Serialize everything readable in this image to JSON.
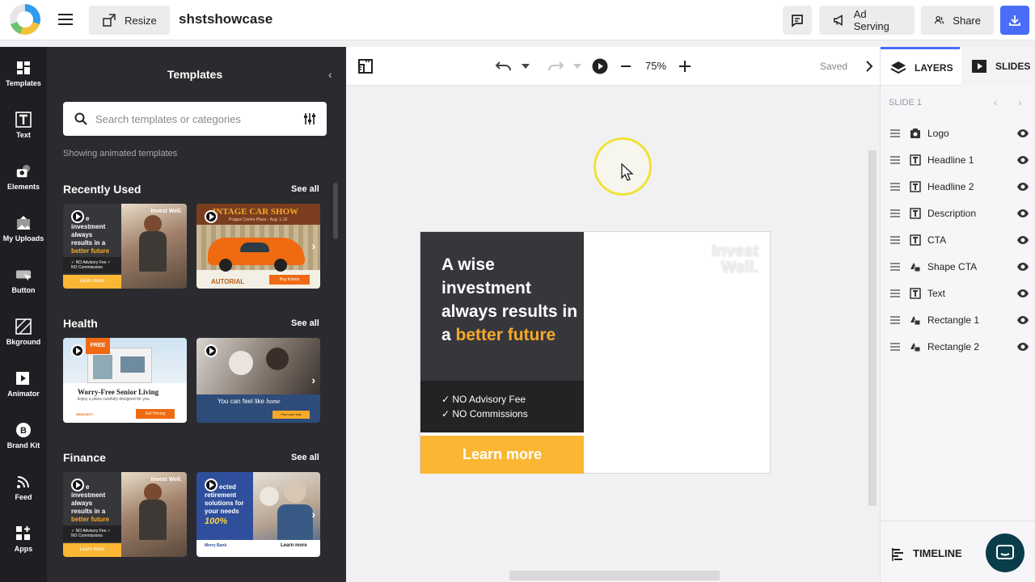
{
  "app": {
    "doc_title": "shstshowcase",
    "resize_label": "Resize",
    "ad_serving_label": "Ad Serving",
    "share_label": "Share"
  },
  "rail": [
    {
      "label": "Templates",
      "icon": "templates-icon"
    },
    {
      "label": "Text",
      "icon": "text-icon"
    },
    {
      "label": "Elements",
      "icon": "elements-icon"
    },
    {
      "label": "My Uploads",
      "icon": "uploads-icon"
    },
    {
      "label": "Button",
      "icon": "button-icon"
    },
    {
      "label": "Bkground",
      "icon": "background-icon"
    },
    {
      "label": "Animator",
      "icon": "animator-icon"
    },
    {
      "label": "Brand Kit",
      "icon": "brand-kit-icon"
    },
    {
      "label": "Feed",
      "icon": "feed-icon"
    },
    {
      "label": "Apps",
      "icon": "apps-icon"
    }
  ],
  "panel": {
    "title": "Templates",
    "search_placeholder": "Search templates or categories",
    "showing": "Showing animated templates",
    "see_all": "See all",
    "sections": [
      {
        "title": "Recently Used"
      },
      {
        "title": "Health"
      },
      {
        "title": "Finance"
      }
    ],
    "thumbs": {
      "invest_line1": "e",
      "invest_line2": "investment",
      "invest_line3": "always",
      "invest_line4": "results in a",
      "invest_accent": "better future",
      "invest_logo": "Invest Well.",
      "invest_desc": "✓ NO Advisory Fee ✓ NO Commissions",
      "invest_cta": "Learn more",
      "car_title": "INTAGE CAR SHOW",
      "car_sub": "Prague Centre Plaza · Aug. 1-15",
      "car_brand": "AUTORIAL",
      "car_cta": "Buy tickets",
      "senior_badge": "FREE",
      "senior_title": "Worry-Free Senior Living",
      "senior_sub": "Enjoy a place carefully designed for you.",
      "senior_cta": "Get Pricing",
      "senior_brand": "SENIORITY",
      "care_text": "You can feel like",
      "care_accent": "home",
      "care_cta": "Plan your visit",
      "retire_l1": "ected",
      "retire_l2": "retirement",
      "retire_l3": "solutions for",
      "retire_l4": "your needs",
      "retire_pct": "100%",
      "retire_brand": "Merry Bank",
      "retire_cta": "Learn more"
    }
  },
  "canvas": {
    "zoom": "75%",
    "saved": "Saved",
    "ad": {
      "headline1": "A wise investment always results in a",
      "headline2": "better future",
      "desc1": "✓ NO Advisory Fee",
      "desc2": "✓ NO Commissions",
      "cta": "Learn more",
      "logo_line1": "Invest",
      "logo_line2": "Well."
    }
  },
  "right": {
    "tab_layers": "LAYERS",
    "tab_slides": "SLIDES",
    "slide_label": "SLIDE 1",
    "layers": [
      {
        "name": "Logo",
        "type": "image"
      },
      {
        "name": "Headline 1",
        "type": "text"
      },
      {
        "name": "Headline 2",
        "type": "text"
      },
      {
        "name": "Description",
        "type": "text"
      },
      {
        "name": "CTA",
        "type": "text"
      },
      {
        "name": "Shape CTA",
        "type": "shape"
      },
      {
        "name": "Text",
        "type": "text"
      },
      {
        "name": "Rectangle 1",
        "type": "shape"
      },
      {
        "name": "Rectangle 2",
        "type": "shape"
      }
    ],
    "timeline_label": "TIMELINE"
  },
  "colors": {
    "accent": "#4a6cf7",
    "cta_yellow": "#fbb733",
    "orange_text": "#f7a929",
    "dark_panel": "#2b2b2f"
  }
}
